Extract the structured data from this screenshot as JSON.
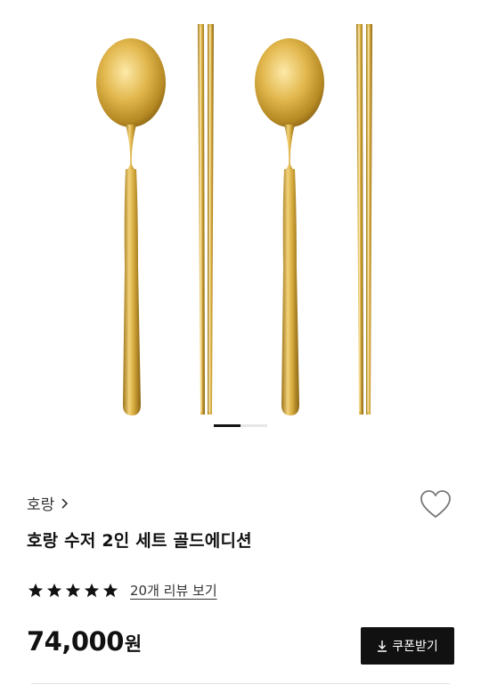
{
  "product": {
    "brand": "호랑",
    "title": "호랑 수저 2인 세트 골드에디션",
    "rating": 5,
    "rating_max": 5,
    "review_link": "20개 리뷰 보기",
    "price": "74,000",
    "currency": "원",
    "wishlisted": false
  },
  "coupon": {
    "label": "쿠폰받기",
    "icon": "download-icon"
  },
  "gallery": {
    "active_index": 0,
    "total": 2
  },
  "colors": {
    "accent": "#111111",
    "gold": "#d6ab3d"
  }
}
